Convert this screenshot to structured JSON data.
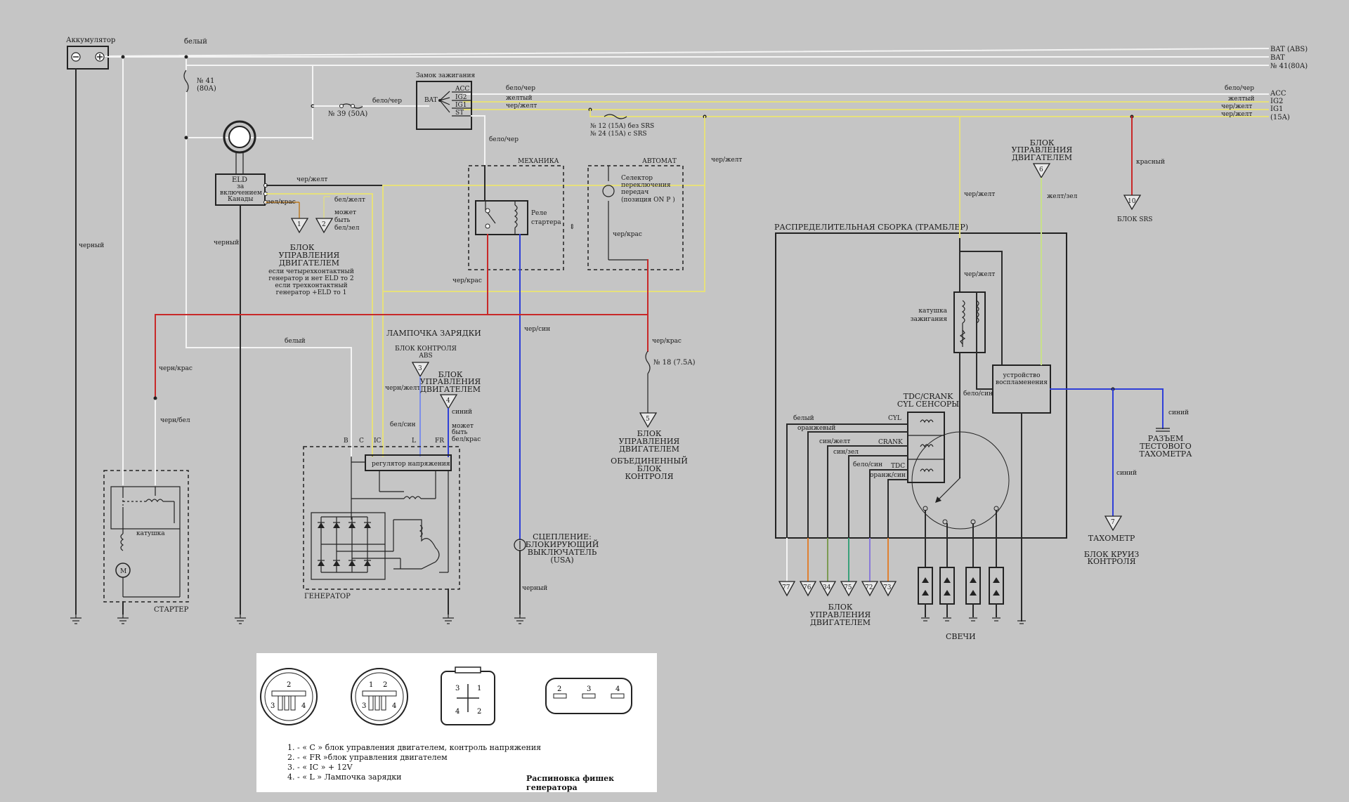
{
  "wires_right": [
    "BAT (ABS)",
    "BAT",
    "№ 41(80A)",
    "ACC",
    "IG2",
    "IG1",
    "(15A)"
  ],
  "wires_right_colors": [
    "бело/чер",
    "желтый",
    "чер/желт",
    "чер/желт"
  ],
  "battery": {
    "label": "Аккумулятор",
    "wire_top": "белый",
    "wire_down": "черный"
  },
  "fuse41": {
    "label": "№ 41",
    "rating": "(80A)"
  },
  "fuse39": {
    "label": "№ 39  (50A)",
    "wire": "бело/чер"
  },
  "ignition": {
    "title": "Замок зажигания",
    "bat": "BAT",
    "acc": "ACC",
    "ig2": "IG2",
    "ig1": "IG1",
    "st": "ST",
    "w_acc": "бело/чер",
    "w_ig2": "желтый",
    "w_ig1": "чер/желт",
    "w_st": "бело/чер"
  },
  "fuse12": {
    "line1": "№ 12 (15A) без SRS",
    "line2": "№ 24 (15A) с SRS"
  },
  "eld": {
    "title": "ELD",
    "line2": "за",
    "line3": "включением",
    "line4": "Канады",
    "w_out": "чер/желт",
    "w_gr": "зел/крас",
    "w_bw": "бел/желт",
    "w_down": "черный"
  },
  "eld_ecu": {
    "pin1": "1",
    "pin2": "2",
    "maybe": [
      "может",
      "быть",
      "бел/зел"
    ],
    "title": [
      "БЛОК",
      "УПРАВЛЕНИЯ",
      "ДВИГАТЕЛЕМ"
    ],
    "note": [
      "если четырехконтактный",
      "генератор и нет ELD то 2",
      "если трехконтактный",
      "генератор +ELD то 1"
    ]
  },
  "mech": {
    "title": "МЕХАНИКА",
    "relay": [
      "Реле",
      "стартера"
    ],
    "w_in": "чер/крас"
  },
  "auto": {
    "title": "АВТОМАТ",
    "selector": [
      "Селектор",
      "переключения",
      "передач",
      "(позиция ON P )"
    ],
    "w": "чер/крас"
  },
  "w_chzh": "чер/желт",
  "w_chs": "чер/син",
  "starter": {
    "title": "СТАРТЕР",
    "coil": "катушка",
    "motor": "M",
    "w_red": "черн/крас",
    "w_wh": "черн/бел"
  },
  "lamp": {
    "title": "ЛАМПОЧКА ЗАРЯДКИ",
    "abs": [
      "БЛОК КОНТРОЛЯ",
      "ABS"
    ],
    "pin3": "3",
    "ecu": [
      "БЛОК",
      "УПРАВЛЕНИЯ",
      "ДВИГАТЕЛЕМ"
    ],
    "pin4": "4",
    "w_blue": "синий",
    "maybe": [
      "может",
      "быть",
      "бел/крас"
    ],
    "w_bs": "бел/син",
    "w_cy": "черн/желт",
    "w_white": "белый"
  },
  "generator": {
    "title": "ГЕНЕРАТОР",
    "reg": "регулятор напряжения",
    "B": "B",
    "C": "C",
    "IC": "IC",
    "L": "L",
    "FR": "FR"
  },
  "fuse18": {
    "label": "№ 18 (7.5A)",
    "w": "чер/крас",
    "pin": "5",
    "ecu": [
      "БЛОК",
      "УПРАВЛЕНИЯ",
      "ДВИГАТЕЛЕМ"
    ],
    "combined": [
      "ОБЪЕДИНЕННЫЙ",
      "БЛОК",
      "КОНТРОЛЯ"
    ]
  },
  "clutch": {
    "lines": [
      "СЦЕПЛЕНИЕ:",
      "БЛОКИРУЮЩИЙ",
      "ВЫКЛЮЧАТЕЛЬ",
      "(USA)"
    ],
    "w": "черный"
  },
  "dist": {
    "title": "РАСПРЕДЕЛИТЕЛЬНАЯ СБОРКА (ТРАМБЛЕР)",
    "coil": [
      "катушка",
      "зажигания"
    ],
    "igniter": [
      "устройство",
      "воспламенения"
    ],
    "sensors": [
      "TDC/CRANK",
      "CYL СЕНСОРЫ"
    ],
    "cyl": "CYL",
    "crank": "CRANK",
    "tdc": "TDC",
    "w_cy": "чер/желт",
    "w_bs": "бело/син",
    "w_cy2": "чер/желт",
    "w_s": [
      "белый",
      "оранжевый",
      "син/желт",
      "син/зел",
      "бело/син",
      "оранж/син"
    ]
  },
  "ecu6": {
    "title": [
      "БЛОК",
      "УПРАВЛЕНИЯ",
      "ДВИГАТЕЛЕМ"
    ],
    "pin": "6",
    "w": "желт/зел"
  },
  "srs": {
    "pin": "10",
    "label": "БЛОК SRS",
    "w": "красный"
  },
  "tach": {
    "conn": [
      "РАЗЪЕМ",
      "ТЕСТОВОГО",
      "ТАХОМЕТРА"
    ],
    "w1": "синий",
    "w2": "синий",
    "pin": "7",
    "title": "ТАХОМЕТР",
    "cruise": [
      "БЛОК КРУИЗ",
      "КОНТРОЛЯ"
    ]
  },
  "ecu_bottom": {
    "pins": [
      "77",
      "76",
      "34",
      "75",
      "72",
      "73"
    ],
    "title": [
      "БЛОК",
      "УПРАВЛЕНИЯ",
      "ДВИГАТЕЛЕМ"
    ]
  },
  "plugs": {
    "label": "СВЕЧИ"
  },
  "connectors": {
    "c1": [
      "2",
      "3",
      "4"
    ],
    "c2": [
      "1",
      "2",
      "3",
      "4"
    ],
    "c3": [
      "3",
      "1",
      "4",
      "2"
    ],
    "c4": [
      "2",
      "3",
      "4"
    ]
  },
  "legend": {
    "items": [
      "1.  - « C » блок управления двигателем, контроль напряжения",
      "2.  - « FR »блок управления двигателем",
      "3.  - « IC »  + 12V",
      "4.  - « L »  Лампочка зарядки"
    ],
    "caption": "Распиновка фишек генератора"
  },
  "colors": {
    "background": "#c5c5c5",
    "white_wire": "#f4f4f4",
    "yellow_wire": "#e6e07c",
    "red_wire": "#c82828",
    "blue_wire": "#2f3fd8",
    "black_wire": "#2a2a2a"
  }
}
